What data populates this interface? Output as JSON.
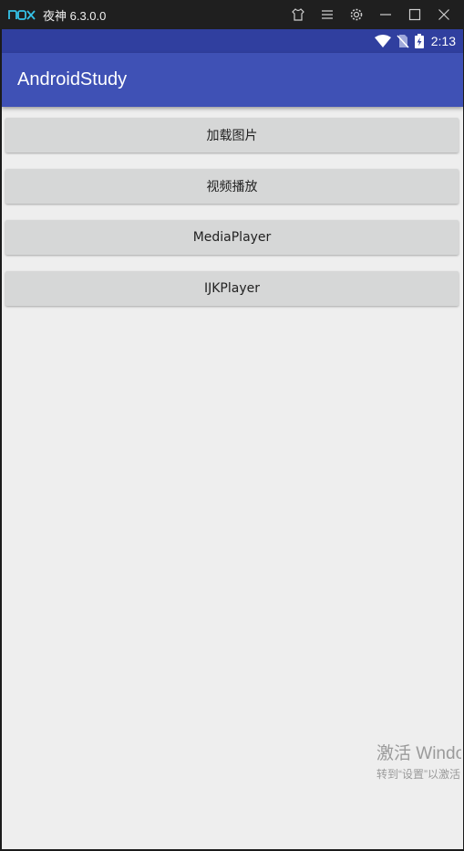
{
  "emulator": {
    "title": "夜神 6.3.0.0",
    "icons": [
      "shirt-icon",
      "menu-icon",
      "gear-icon",
      "minimize-icon",
      "maximize-icon",
      "close-icon"
    ]
  },
  "status_bar": {
    "time": "2:13",
    "icons": [
      "wifi-icon",
      "no-sim-icon",
      "battery-charging-icon"
    ]
  },
  "app_bar": {
    "title": "AndroidStudy",
    "color": "#3f51b5",
    "status_color": "#303f9f"
  },
  "buttons": [
    {
      "label": "加载图片"
    },
    {
      "label": "视频播放"
    },
    {
      "label": "MediaPlayer"
    },
    {
      "label": "IJKPlayer"
    }
  ],
  "watermark": {
    "line1": "激活 Windows",
    "line2": "转到“设置”以激活 Windows。"
  }
}
